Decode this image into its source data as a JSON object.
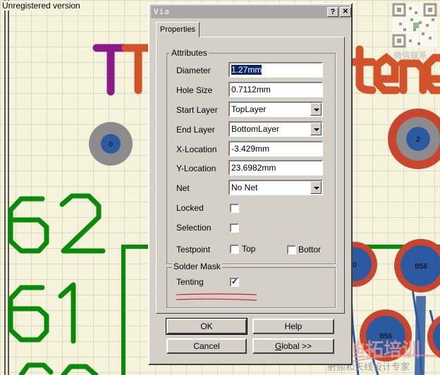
{
  "background": {
    "unregistered_text": "Unregistered version",
    "pads": [
      {
        "label": "0"
      },
      {
        "label": "2"
      },
      {
        "label": "0"
      },
      {
        "label": "B58"
      },
      {
        "label": "B56"
      }
    ],
    "silkscreen": {
      "top": "T",
      "mid": "tte",
      "left_digits": [
        "62",
        "61"
      ]
    },
    "watermark": {
      "qr_caption": "微信联系",
      "brand": "易迪拓培训",
      "brand_sub": "射频和天线设计专家"
    }
  },
  "dialog": {
    "title": "Via",
    "help_glyph": "?",
    "close_glyph": "✕",
    "tab_label": "Properties",
    "attributes": {
      "group_label": "Attributes",
      "diameter": {
        "label": "Diameter",
        "value": "1.27mm"
      },
      "hole_size": {
        "label": "Hole Size",
        "value": "0.7112mm"
      },
      "start_layer": {
        "label": "Start Layer",
        "value": "TopLayer"
      },
      "end_layer": {
        "label": "End Layer",
        "value": "BottomLayer"
      },
      "x_location": {
        "label": "X-Location",
        "value": "-3.429mm"
      },
      "y_location": {
        "label": "Y-Location",
        "value": "23.6982mm"
      },
      "net": {
        "label": "Net",
        "value": "No Net"
      },
      "locked": {
        "label": "Locked",
        "checked": false
      },
      "selection": {
        "label": "Selection",
        "checked": false
      },
      "testpoint": {
        "label": "Testpoint",
        "top_label": "Top",
        "top_checked": false,
        "bottom_label": "Bottor",
        "bottom_checked": false
      }
    },
    "solder_mask": {
      "group_label": "Solder Mask",
      "tenting": {
        "label": "Tenting",
        "checked": true,
        "check_glyph": "✓"
      }
    },
    "buttons": {
      "ok": "OK",
      "help": "Help",
      "cancel": "Cancel",
      "global_prefix": "G",
      "global_rest": "lobal >>"
    }
  },
  "colors": {
    "grid_bg": "#f6f3dc",
    "track_green": "#0a8a0a",
    "silk_purple": "#8a1a8a",
    "silk_orange": "#d2522a",
    "pad_red": "#c8462e",
    "pad_blue": "#2c5aa0",
    "pad_gray": "#8c8c8c",
    "dialog_face": "#d4d0c8",
    "selection_blue": "#0a246a"
  }
}
